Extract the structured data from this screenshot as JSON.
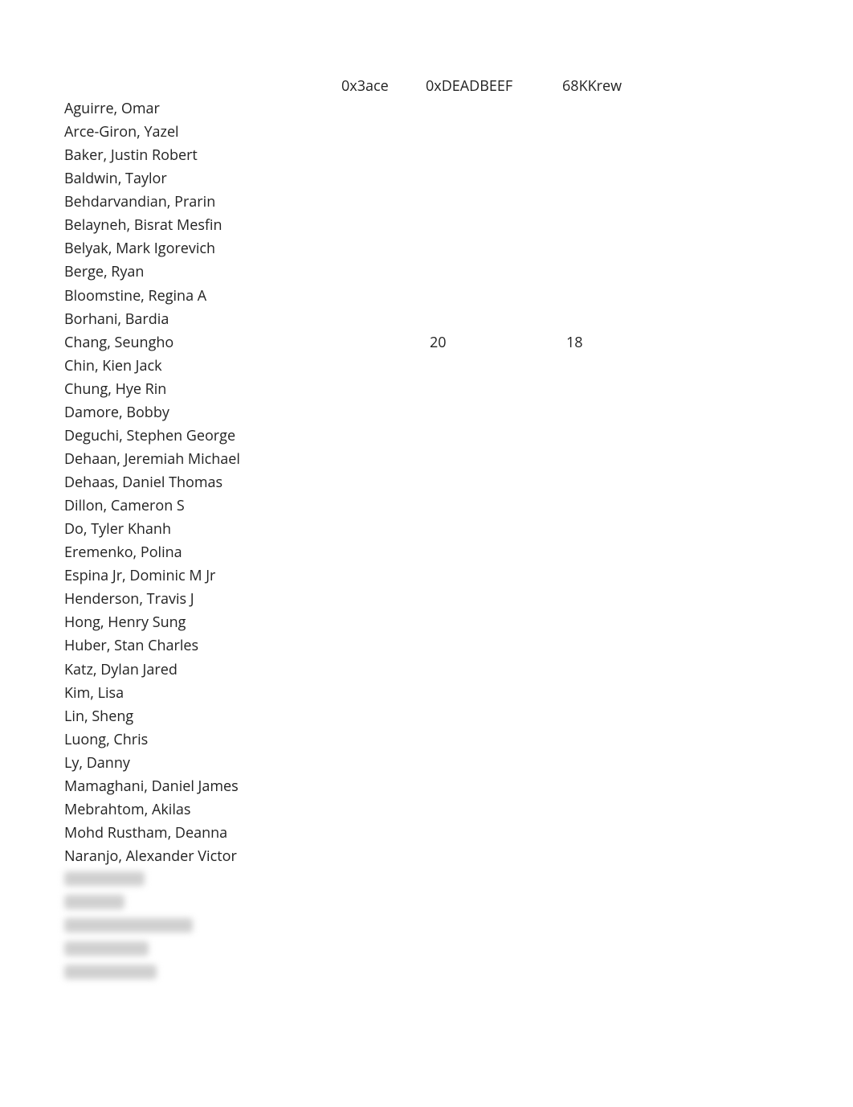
{
  "columns": {
    "col1": "0x3ace",
    "col2": "0xDEADBEEF",
    "col3": "68KKrew"
  },
  "names": [
    "Aguirre, Omar",
    "Arce-Giron, Yazel",
    "Baker, Justin Robert",
    "Baldwin, Taylor",
    "Behdarvandian, Prarin",
    "Belayneh, Bisrat Mesfin",
    "Belyak, Mark Igorevich",
    "Berge, Ryan",
    "Bloomstine, Regina A",
    "Borhani, Bardia",
    "Chang, Seungho",
    "Chin, Kien Jack",
    "Chung, Hye Rin",
    "Damore, Bobby",
    "Deguchi, Stephen George",
    "Dehaan, Jeremiah Michael",
    "Dehaas, Daniel Thomas",
    "Dillon, Cameron S",
    "Do, Tyler Khanh",
    "Eremenko, Polina",
    "Espina Jr, Dominic M Jr",
    "Henderson, Travis J",
    "Hong, Henry Sung",
    "Huber, Stan Charles",
    "Katz, Dylan Jared",
    "Kim, Lisa",
    "Lin, Sheng",
    "Luong, Chris",
    "Ly, Danny",
    "Mamaghani, Daniel James",
    "Mebrahtom, Akilas",
    "Mohd Rustham, Deanna",
    "Naranjo, Alexander Victor"
  ],
  "data_row": {
    "index": 10,
    "col2_value": "20",
    "col3_value": "18"
  }
}
